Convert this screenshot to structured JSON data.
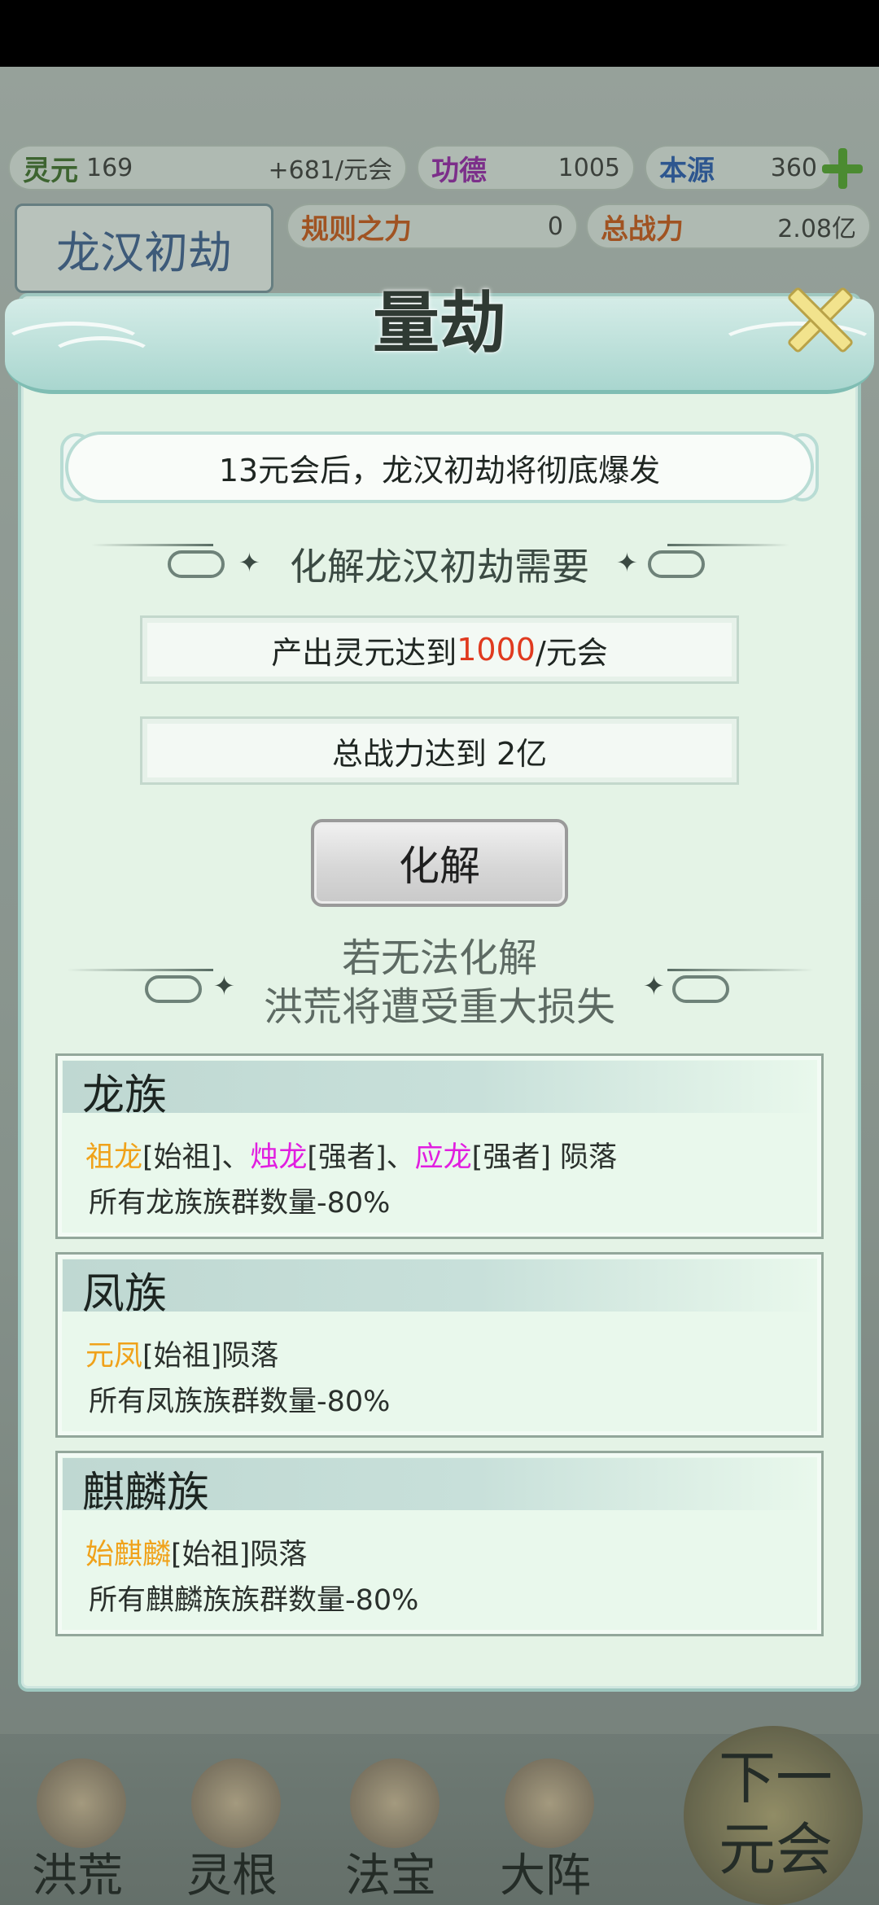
{
  "top_bar": {
    "lingyuan_label": "灵元",
    "lingyuan_value": "169",
    "lingyuan_rate": "+681/元会",
    "gongde_label": "功德",
    "gongde_value": "1005",
    "benyuan_label": "本源",
    "benyuan_value": "360",
    "guize_label": "规则之力",
    "guize_value": "0",
    "zongzhanli_label": "总战力",
    "zongzhanli_value": "2.08亿",
    "badge_title": "龙汉初劫"
  },
  "dialog": {
    "title": "量劫",
    "banner_text": "13元会后，龙汉初劫将彻底爆发",
    "requirement_heading": "化解龙汉初劫需要",
    "req1_prefix": "产出灵元达到 ",
    "req1_value": "1000",
    "req1_suffix": "/元会",
    "req2_text": "总战力达到  2亿",
    "resolve_button": "化解",
    "warning_line1": "若无法化解",
    "warning_line2": "洪荒将遭受重大损失",
    "cards": [
      {
        "title": "龙族",
        "names": [
          {
            "name": "祖龙",
            "rank": "[始祖]、",
            "color": "#f0a21a"
          },
          {
            "name": "烛龙",
            "rank": "[强者]、",
            "color": "#e11ee0"
          },
          {
            "name": "应龙",
            "rank": "[强者] 陨落",
            "color": "#e11ee0"
          }
        ],
        "effect": "所有龙族族群数量-80%"
      },
      {
        "title": "凤族",
        "names": [
          {
            "name": "元凤",
            "rank": "[始祖]陨落",
            "color": "#f0a21a"
          }
        ],
        "effect": "所有凤族族群数量-80%"
      },
      {
        "title": "麒麟族",
        "names": [
          {
            "name": "始麒麟",
            "rank": "[始祖]陨落",
            "color": "#f0a21a"
          }
        ],
        "effect": "所有麒麟族族群数量-80%"
      }
    ]
  },
  "bottom_nav": {
    "items": [
      "洪荒",
      "灵根",
      "法宝",
      "大阵"
    ],
    "next_line1": "下一",
    "next_line2": "元会"
  }
}
